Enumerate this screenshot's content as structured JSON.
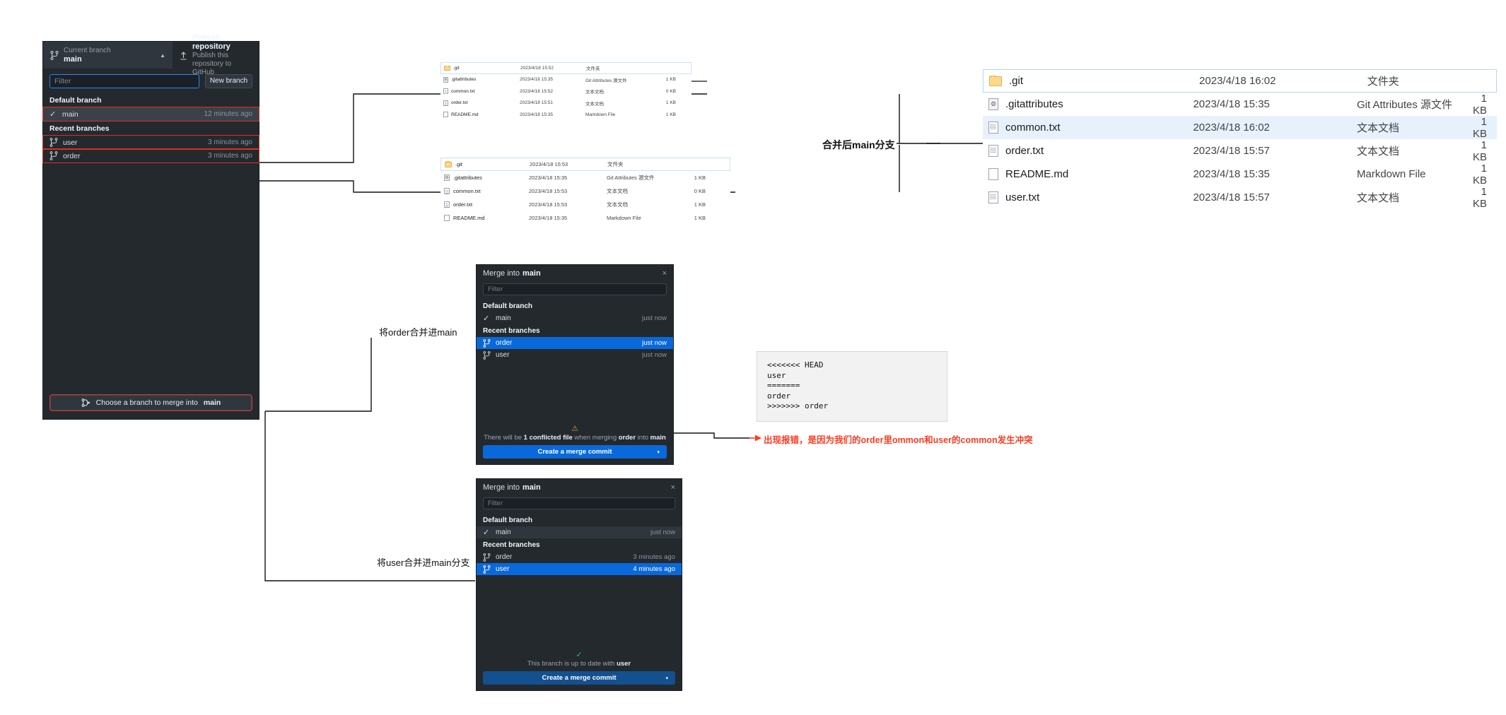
{
  "branch_panel": {
    "current_branch_label": "Current branch",
    "current_branch_name": "main",
    "publish_title": "Publish repository",
    "publish_sub": "Publish this repository to GitHub",
    "filter_placeholder": "Filter",
    "new_branch_label": "New branch",
    "default_branch_header": "Default branch",
    "recent_branches_header": "Recent branches",
    "default_branches": [
      {
        "name": "main",
        "time": "12 minutes ago"
      }
    ],
    "recent_branches": [
      {
        "name": "user",
        "time": "3 minutes ago"
      },
      {
        "name": "order",
        "time": "3 minutes ago"
      }
    ],
    "merge_button_prefix": "Choose a branch to merge into",
    "merge_button_branch": "main"
  },
  "explorer_top": {
    "rows": [
      {
        "name": ".git",
        "date": "2023/4/18 15:52",
        "type": "文件夹",
        "size": "",
        "icon": "folder-icon"
      },
      {
        "name": ".gitattributes",
        "date": "2023/4/18 15:35",
        "type": "Git Attributes 源文件",
        "size": "1 KB",
        "icon": "gear-file-icon"
      },
      {
        "name": "common.txt",
        "date": "2023/4/18 15:52",
        "type": "文本文档",
        "size": "0 KB",
        "icon": "text-file-icon"
      },
      {
        "name": "order.txt",
        "date": "2023/4/18 15:51",
        "type": "文本文档",
        "size": "1 KB",
        "icon": "text-file-icon"
      },
      {
        "name": "README.md",
        "date": "2023/4/18 15:35",
        "type": "Markdown File",
        "size": "1 KB",
        "icon": "markdown-file-icon"
      }
    ]
  },
  "explorer_mid": {
    "rows": [
      {
        "name": ".git",
        "date": "2023/4/18 15:53",
        "type": "文件夹",
        "size": "",
        "icon": "folder-icon"
      },
      {
        "name": ".gitattributes",
        "date": "2023/4/18 15:35",
        "type": "Git Attributes 源文件",
        "size": "1 KB",
        "icon": "gear-file-icon"
      },
      {
        "name": "common.txt",
        "date": "2023/4/18 15:53",
        "type": "文本文档",
        "size": "0 KB",
        "icon": "text-file-icon"
      },
      {
        "name": "order.txt",
        "date": "2023/4/18 15:53",
        "type": "文本文档",
        "size": "1 KB",
        "icon": "text-file-icon"
      },
      {
        "name": "README.md",
        "date": "2023/4/18 15:35",
        "type": "Markdown File",
        "size": "1 KB",
        "icon": "markdown-file-icon"
      }
    ]
  },
  "explorer_big": {
    "rows": [
      {
        "name": ".git",
        "date": "2023/4/18 16:02",
        "type": "文件夹",
        "size": "",
        "icon": "folder-icon",
        "selected": false,
        "focused": true
      },
      {
        "name": ".gitattributes",
        "date": "2023/4/18 15:35",
        "type": "Git Attributes 源文件",
        "size": "1 KB",
        "icon": "gear-file-icon",
        "selected": false,
        "focused": false
      },
      {
        "name": "common.txt",
        "date": "2023/4/18 16:02",
        "type": "文本文档",
        "size": "1 KB",
        "icon": "text-file-icon",
        "selected": true,
        "focused": false
      },
      {
        "name": "order.txt",
        "date": "2023/4/18 15:57",
        "type": "文本文档",
        "size": "1 KB",
        "icon": "text-file-icon",
        "selected": false,
        "focused": false
      },
      {
        "name": "README.md",
        "date": "2023/4/18 15:35",
        "type": "Markdown File",
        "size": "1 KB",
        "icon": "markdown-file-icon",
        "selected": false,
        "focused": false
      },
      {
        "name": "user.txt",
        "date": "2023/4/18 15:57",
        "type": "文本文档",
        "size": "1 KB",
        "icon": "text-file-icon",
        "selected": false,
        "focused": false
      }
    ]
  },
  "merge_dialog_order": {
    "title_prefix": "Merge into",
    "title_branch": "main",
    "close_label": "×",
    "filter_placeholder": "Filter",
    "default_branch_header": "Default branch",
    "recent_branches_header": "Recent branches",
    "default_branches": [
      {
        "name": "main",
        "time": "just now"
      }
    ],
    "recent_branches": [
      {
        "name": "order",
        "time": "just now",
        "selected": true
      },
      {
        "name": "user",
        "time": "just now",
        "selected": false
      }
    ],
    "status_icon": "warning-icon",
    "status_text_1": "There will be ",
    "status_strong_1": "1 conflicted file",
    "status_text_2": " when merging ",
    "status_strong_2": "order",
    "status_text_3": " into ",
    "status_strong_3": "main",
    "cta_label": "Create a merge commit",
    "cta_arrow": "▾"
  },
  "merge_dialog_user": {
    "title_prefix": "Merge into",
    "title_branch": "main",
    "close_label": "×",
    "filter_placeholder": "Filter",
    "default_branch_header": "Default branch",
    "recent_branches_header": "Recent branches",
    "default_branches": [
      {
        "name": "main",
        "time": "just now"
      }
    ],
    "recent_branches": [
      {
        "name": "order",
        "time": "3 minutes ago",
        "selected": false
      },
      {
        "name": "user",
        "time": "4 minutes ago",
        "selected": true
      }
    ],
    "status_icon": "check-icon",
    "status_text_1": "This branch is up to date with ",
    "status_strong_1": "user",
    "cta_label": "Create a merge commit",
    "cta_arrow": "▾"
  },
  "conflict_box": {
    "code": "<<<<<<< HEAD\nuser\n=======\norder\n>>>>>>> order"
  },
  "annotations": {
    "merged_main": "合并后main分支",
    "merge_order_into_main": "将order合并进main",
    "merge_user_into_main": "将user合并进main分支",
    "conflict_explanation": "出现报错，是因为我们的order里ommon和user的common发生冲突"
  },
  "colors": {
    "accent_blue": "#0969da",
    "panel_dark": "#24292e",
    "row_selected_dark": "#3a4149",
    "explorer_selected": "#e6f1fb",
    "annotation_red": "#ff3b21",
    "outline_red": "#d93025",
    "warning_amber": "#d29922",
    "success_green": "#3fb950"
  }
}
